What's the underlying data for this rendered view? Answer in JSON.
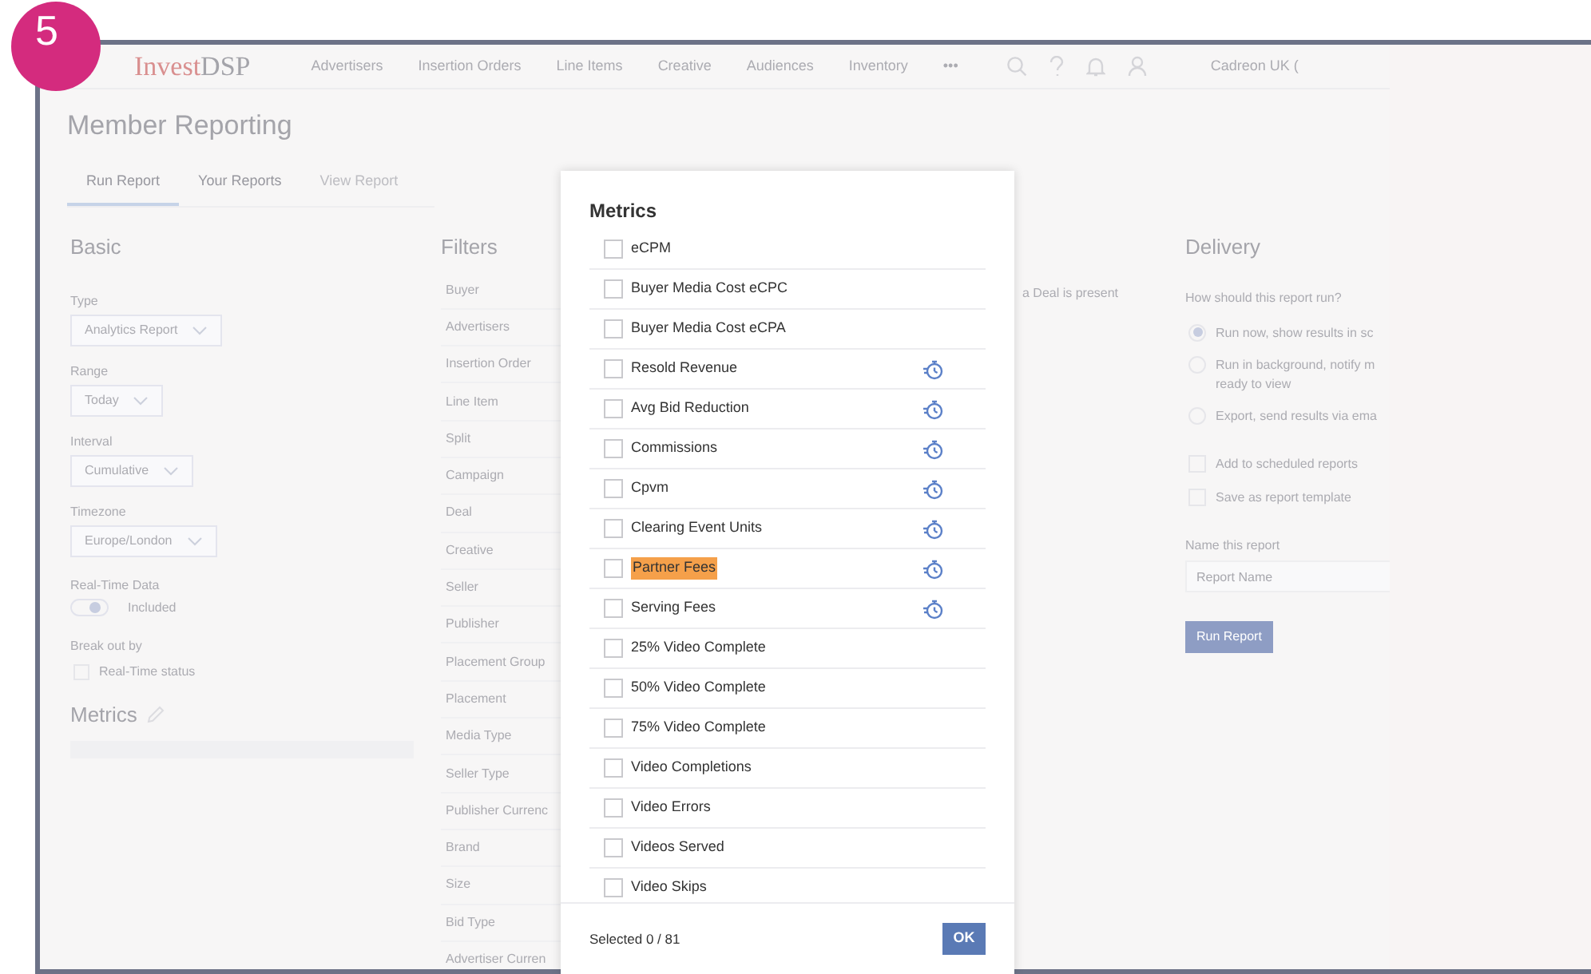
{
  "step_badge": "5",
  "nav": {
    "logo_first": "Invest",
    "logo_second": "DSP",
    "items": [
      {
        "label": "Advertisers"
      },
      {
        "label": "Insertion Orders"
      },
      {
        "label": "Line Items"
      },
      {
        "label": "Creative"
      },
      {
        "label": "Audiences"
      },
      {
        "label": "Inventory"
      },
      {
        "label": "•••"
      }
    ],
    "account": "Cadreon UK ("
  },
  "page_title": "Member Reporting",
  "tabs": [
    {
      "label": "Run Report",
      "selected": true,
      "disabled": false
    },
    {
      "label": "Your Reports",
      "selected": false,
      "disabled": false
    },
    {
      "label": "View Report",
      "selected": false,
      "disabled": true
    }
  ],
  "basic": {
    "title": "Basic",
    "fields": [
      {
        "label": "Type",
        "value": "Analytics Report"
      },
      {
        "label": "Range",
        "value": "Today"
      },
      {
        "label": "Interval",
        "value": "Cumulative"
      },
      {
        "label": "Timezone",
        "value": "Europe/London"
      }
    ],
    "realtime": {
      "label": "Real-Time Data",
      "on": true,
      "text": "Included"
    },
    "breakout": {
      "label": "Break out by",
      "option": "Real-Time status",
      "checked": false
    },
    "metrics_title": "Metrics"
  },
  "filters": {
    "title": "Filters",
    "items": [
      "Buyer",
      "Advertisers",
      "Insertion Order",
      "Line Item",
      "Split",
      "Campaign",
      "Deal",
      "Creative",
      "Seller",
      "Publisher",
      "Placement Group",
      "Placement",
      "Media Type",
      "Seller Type",
      "Publisher Currenc",
      "Brand",
      "Size",
      "Bid Type",
      "Advertiser Curren"
    ]
  },
  "middle_note": "a Deal is present",
  "delivery": {
    "title": "Delivery",
    "question": "How should this report run?",
    "options": [
      {
        "label": "Run now, show results in sc",
        "selected": true
      },
      {
        "label": "Run in background, notify m",
        "sublabel": "ready to view",
        "selected": false
      },
      {
        "label": "Export, send results via ema",
        "selected": false
      }
    ],
    "checks": [
      {
        "label": "Add to scheduled reports",
        "checked": false
      },
      {
        "label": "Save as report template",
        "checked": false
      }
    ],
    "name_label": "Name this report",
    "name_placeholder": "Report Name",
    "run_button": "Run Report"
  },
  "modal": {
    "title": "Metrics",
    "items": [
      {
        "label": "eCPM",
        "checked": false,
        "highlighted": false,
        "realtime": false
      },
      {
        "label": "Buyer Media Cost eCPC",
        "checked": false,
        "highlighted": false,
        "realtime": false
      },
      {
        "label": "Buyer Media Cost eCPA",
        "checked": false,
        "highlighted": false,
        "realtime": false
      },
      {
        "label": "Resold Revenue",
        "checked": false,
        "highlighted": false,
        "realtime": true
      },
      {
        "label": "Avg Bid Reduction",
        "checked": false,
        "highlighted": false,
        "realtime": true
      },
      {
        "label": "Commissions",
        "checked": false,
        "highlighted": false,
        "realtime": true
      },
      {
        "label": "Cpvm",
        "checked": false,
        "highlighted": false,
        "realtime": true
      },
      {
        "label": "Clearing Event Units",
        "checked": false,
        "highlighted": false,
        "realtime": true
      },
      {
        "label": "Partner Fees",
        "checked": false,
        "highlighted": true,
        "realtime": true
      },
      {
        "label": "Serving Fees",
        "checked": false,
        "highlighted": false,
        "realtime": true
      },
      {
        "label": "25% Video Complete",
        "checked": false,
        "highlighted": false,
        "realtime": false
      },
      {
        "label": "50% Video Complete",
        "checked": false,
        "highlighted": false,
        "realtime": false
      },
      {
        "label": "75% Video Complete",
        "checked": false,
        "highlighted": false,
        "realtime": false
      },
      {
        "label": "Video Completions",
        "checked": false,
        "highlighted": false,
        "realtime": false
      },
      {
        "label": "Video Errors",
        "checked": false,
        "highlighted": false,
        "realtime": false
      },
      {
        "label": "Videos Served",
        "checked": false,
        "highlighted": false,
        "realtime": false
      },
      {
        "label": "Video Skips",
        "checked": false,
        "highlighted": false,
        "realtime": false
      }
    ],
    "selected_count": "Selected 0 / 81",
    "ok": "OK"
  }
}
